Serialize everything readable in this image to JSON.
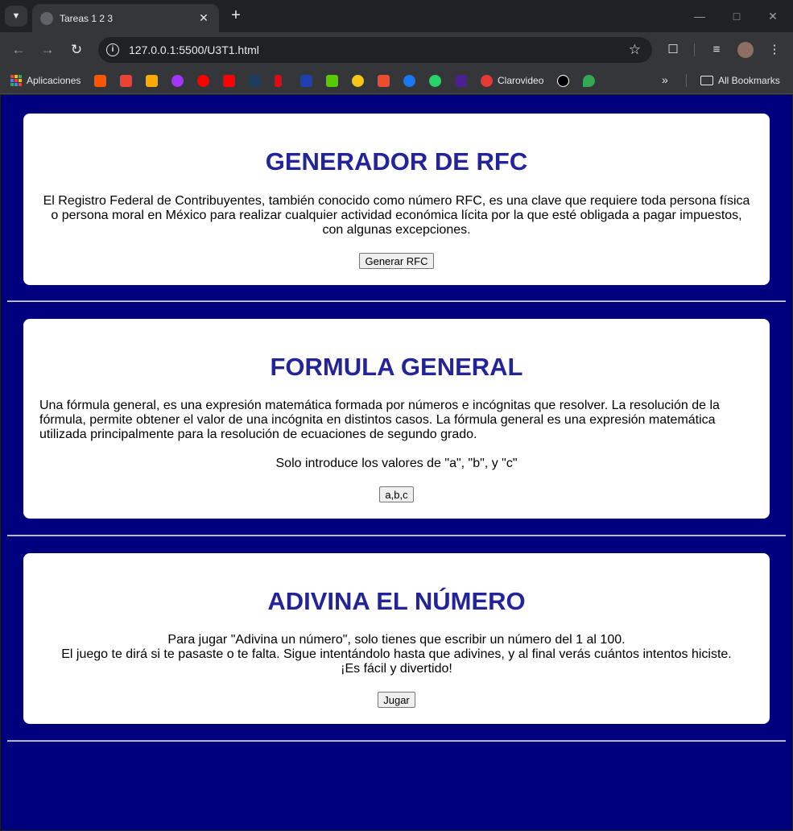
{
  "browser": {
    "tab_title": "Tareas 1 2 3",
    "url": "127.0.0.1:5500/U3T1.html",
    "bookmarks": {
      "apps_label": "Aplicaciones",
      "clarovideo_label": "Clarovideo",
      "all_bookmarks_label": "All Bookmarks"
    }
  },
  "sections": {
    "rfc": {
      "title": "GENERADOR DE RFC",
      "description": "El Registro Federal de Contribuyentes, también conocido como número RFC, es una clave que requiere toda persona física o persona moral en México para realizar cualquier actividad económica lícita por la que esté obligada a pagar impuestos, con algunas excepciones.",
      "button_label": "Generar RFC"
    },
    "formula": {
      "title": "FORMULA GENERAL",
      "description": "Una fórmula general, es una expresión matemática formada por números e incógnitas que resolver. La resolución de la fórmula, permite obtener el valor de una incógnita en distintos casos. La fórmula general es una expresión matemática utilizada principalmente para la resolución de ecuaciones de segundo grado.",
      "instruction": "Solo introduce los valores de \"a\", \"b\", y \"c\"",
      "button_label": "a,b,c"
    },
    "guess": {
      "title": "ADIVINA EL NÚMERO",
      "line1": "Para jugar \"Adivina un número\", solo tienes que escribir un número del 1 al 100.",
      "line2": "El juego te dirá si te pasaste o te falta. Sigue intentándolo hasta que adivines, y al final verás cuántos intentos hiciste.",
      "line3": "¡Es fácil y divertido!",
      "button_label": "Jugar"
    }
  },
  "colors": {
    "page_background": "#00007f",
    "heading": "#23239a",
    "card": "#ffffff"
  }
}
